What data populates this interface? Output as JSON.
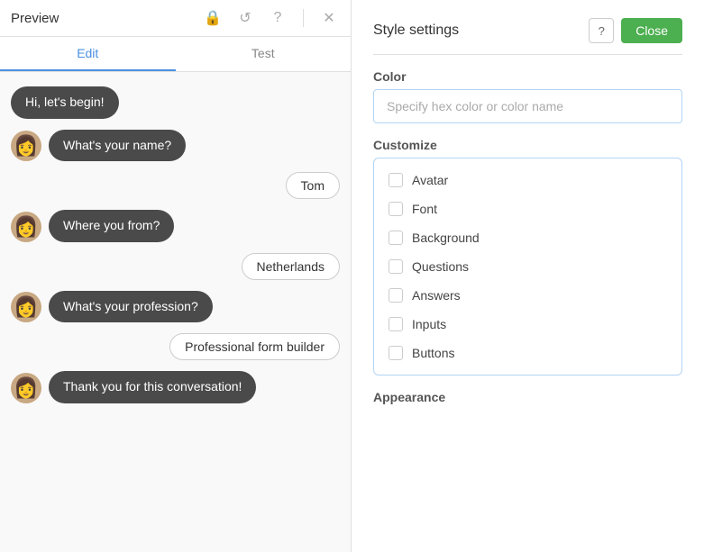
{
  "left": {
    "header": {
      "title": "Preview"
    },
    "tabs": [
      {
        "label": "Edit",
        "active": true
      },
      {
        "label": "Test",
        "active": false
      }
    ],
    "messages": [
      {
        "type": "bot",
        "text": "Hi, let's begin!",
        "showAvatar": false
      },
      {
        "type": "bot",
        "text": "What's your name?",
        "showAvatar": true
      },
      {
        "type": "user",
        "text": "Tom"
      },
      {
        "type": "bot",
        "text": "Where you from?",
        "showAvatar": true
      },
      {
        "type": "user",
        "text": "Netherlands"
      },
      {
        "type": "bot",
        "text": "What's your profession?",
        "showAvatar": true
      },
      {
        "type": "user",
        "text": "Professional form builder"
      },
      {
        "type": "bot",
        "text": "Thank you for this conversation!",
        "showAvatar": true
      }
    ]
  },
  "right": {
    "header": {
      "title": "Style settings",
      "help_label": "?",
      "close_label": "Close"
    },
    "color_section": {
      "label": "Color",
      "placeholder": "Specify hex color or color name"
    },
    "customize_section": {
      "label": "Customize",
      "items": [
        {
          "label": "Avatar",
          "checked": false
        },
        {
          "label": "Font",
          "checked": false
        },
        {
          "label": "Background",
          "checked": false
        },
        {
          "label": "Questions",
          "checked": false
        },
        {
          "label": "Answers",
          "checked": false
        },
        {
          "label": "Inputs",
          "checked": false
        },
        {
          "label": "Buttons",
          "checked": false
        }
      ]
    },
    "appearance_section": {
      "label": "Appearance"
    }
  }
}
